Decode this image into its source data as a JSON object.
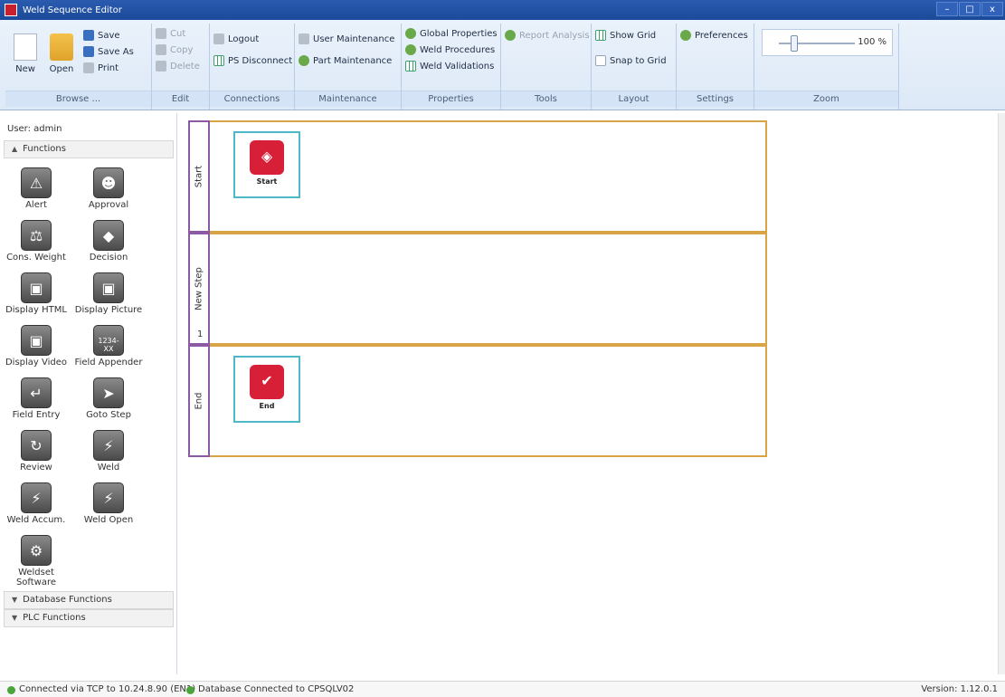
{
  "window": {
    "title": "Weld Sequence Editor",
    "controls": [
      "–",
      "□",
      "x"
    ]
  },
  "ribbon": {
    "browse": {
      "label": "Browse ...",
      "new": "New",
      "open": "Open",
      "save": "Save",
      "save_as": "Save As",
      "print": "Print"
    },
    "edit": {
      "label": "Edit",
      "cut": "Cut",
      "copy": "Copy",
      "delete": "Delete"
    },
    "connections": {
      "label": "Connections",
      "logout": "Logout",
      "ps_disconnect": "PS Disconnect"
    },
    "maintenance": {
      "label": "Maintenance",
      "user_maintenance": "User Maintenance",
      "part_maintenance": "Part Maintenance"
    },
    "properties": {
      "label": "Properties",
      "global_properties": "Global Properties",
      "weld_procedures": "Weld Procedures",
      "weld_validations": "Weld Validations"
    },
    "tools": {
      "label": "Tools",
      "report_analysis": "Report Analysis"
    },
    "layout": {
      "label": "Layout",
      "show_grid": "Show Grid",
      "snap_to_grid": "Snap to Grid"
    },
    "settings": {
      "label": "Settings",
      "preferences": "Preferences"
    },
    "zoom": {
      "label": "Zoom",
      "value": "100 %",
      "level": 0.2
    }
  },
  "left_panel": {
    "user": "User: admin",
    "functions_header": "Functions",
    "functions": [
      {
        "name": "alert",
        "label": "Alert",
        "glyph": "⚠"
      },
      {
        "name": "approval",
        "label": "Approval",
        "glyph": "☻"
      },
      {
        "name": "cons-weight",
        "label": "Cons. Weight",
        "glyph": "⚖"
      },
      {
        "name": "decision",
        "label": "Decision",
        "glyph": "◆"
      },
      {
        "name": "display-html",
        "label": "Display HTML",
        "glyph": "▣"
      },
      {
        "name": "display-picture",
        "label": "Display Picture",
        "glyph": "▣"
      },
      {
        "name": "display-video",
        "label": "Display Video",
        "glyph": "▣"
      },
      {
        "name": "field-appender",
        "label": "Field Appender",
        "glyph": "1234-XX"
      },
      {
        "name": "field-entry",
        "label": "Field Entry",
        "glyph": "↵"
      },
      {
        "name": "goto-step",
        "label": "Goto Step",
        "glyph": "➤"
      },
      {
        "name": "review",
        "label": "Review",
        "glyph": "↻"
      },
      {
        "name": "weld",
        "label": "Weld",
        "glyph": "⚡"
      },
      {
        "name": "weld-accum",
        "label": "Weld Accum.",
        "glyph": "⚡"
      },
      {
        "name": "weld-open",
        "label": "Weld Open",
        "glyph": "⚡"
      },
      {
        "name": "weldset-software",
        "label": "Weldset Software",
        "glyph": "⚙"
      }
    ],
    "database_functions_header": "Database Functions",
    "plc_functions_header": "PLC Functions"
  },
  "canvas": {
    "lanes": [
      {
        "name": "start",
        "title": "Start",
        "number": "",
        "node": {
          "label": "Start",
          "glyph": "◈",
          "icon": "start-icon"
        }
      },
      {
        "name": "new-step",
        "title": "New Step",
        "number": "1",
        "node": null
      },
      {
        "name": "end",
        "title": "End",
        "number": "",
        "node": {
          "label": "End",
          "glyph": "✔",
          "icon": "end-icon"
        }
      }
    ]
  },
  "status": {
    "tcp": "Connected via TCP to 10.24.8.90 (EN1)",
    "database": "Database Connected to CPSQLV02",
    "version": "Version: 1.12.0.1"
  },
  "colors": {
    "titlebar": "#1c4a9a",
    "node_red": "#d81f38",
    "lane_border": "#d9a445",
    "lane_head": "#8c5aa3",
    "node_border": "#4cb8c8"
  }
}
